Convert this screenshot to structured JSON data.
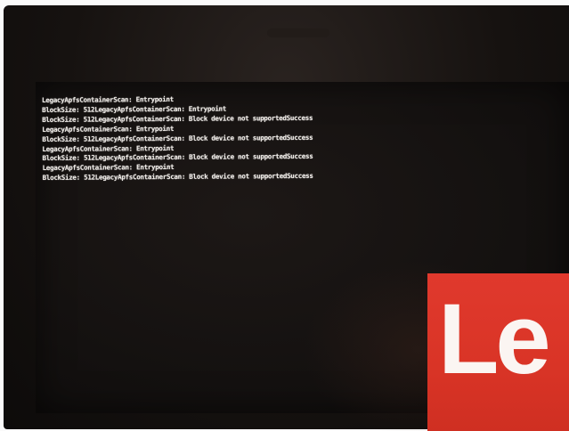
{
  "console": {
    "lines": [
      "LegacyApfsContainerScan: Entrypoint",
      "BlockSize: 512LegacyApfsContainerScan: Entrypoint",
      "BlockSize: 512LegacyApfsContainerScan: Block device not supportedSuccess",
      "LegacyApfsContainerScan: Entrypoint",
      "BlockSize: 512LegacyApfsContainerScan: Block device not supportedSuccess",
      "LegacyApfsContainerScan: Entrypoint",
      "BlockSize: 512LegacyApfsContainerScan: Block device not supportedSuccess",
      "LegacyApfsContainerScan: Entrypoint",
      "BlockSize: 512LegacyApfsContainerScan: Block device not supportedSuccess"
    ]
  },
  "logo": {
    "text": "Le",
    "color": "#d93426"
  },
  "colors": {
    "console_text": "#eeeae6",
    "screen_background": "#141110"
  }
}
